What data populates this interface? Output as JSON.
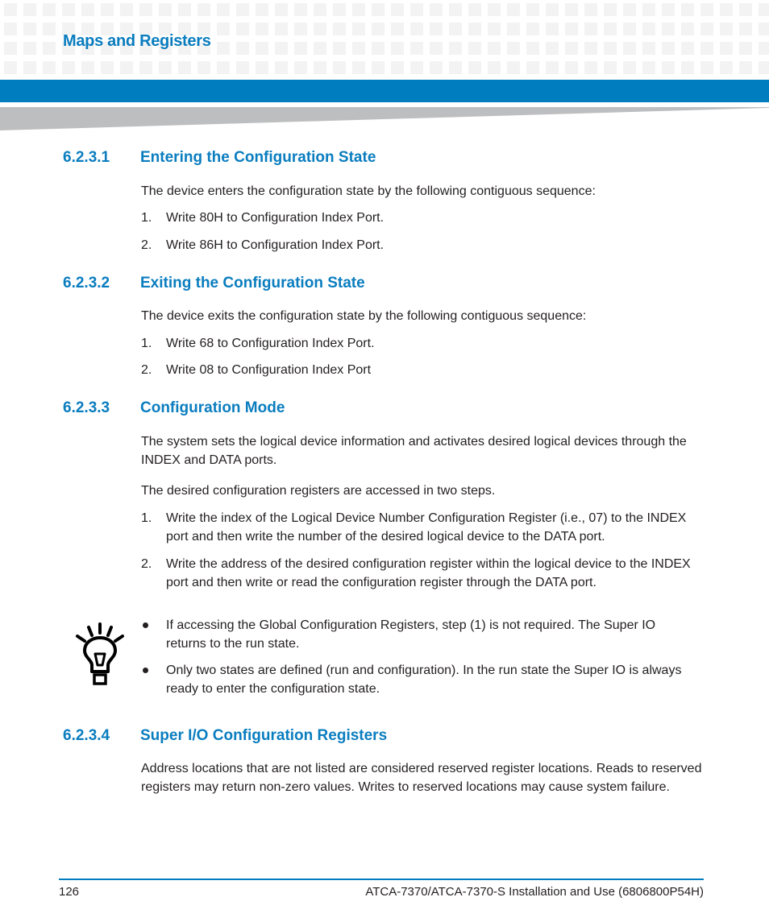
{
  "header": {
    "chapter_title": "Maps and Registers",
    "brand_color": "#007dbe"
  },
  "sections": [
    {
      "number": "6.2.3.1",
      "title": "Entering the Configuration State",
      "intro": "The device enters the configuration state by the following contiguous sequence:",
      "steps": [
        {
          "num": "1.",
          "text": "Write 80H to Configuration Index Port."
        },
        {
          "num": "2.",
          "text": "Write 86H to Configuration Index Port."
        }
      ]
    },
    {
      "number": "6.2.3.2",
      "title": "Exiting the Configuration State",
      "intro": "The device exits the configuration state by the following contiguous sequence:",
      "steps": [
        {
          "num": "1.",
          "text": "Write 68 to Configuration Index Port."
        },
        {
          "num": "2.",
          "text": "Write 08 to Configuration Index Port"
        }
      ]
    },
    {
      "number": "6.2.3.3",
      "title": "Configuration Mode",
      "paragraphs": [
        "The system sets the logical device information and activates desired logical devices through the INDEX and DATA ports.",
        "The desired configuration registers are accessed in two steps."
      ],
      "steps": [
        {
          "num": "1.",
          "text": "Write the index of the Logical Device Number Configuration Register (i.e., 07) to the INDEX port and then write the number of the desired logical device to the DATA port."
        },
        {
          "num": "2.",
          "text": "Write the address of the desired configuration register within the logical device to the INDEX port and then write or read the configuration register through the DATA port."
        }
      ],
      "note": {
        "icon": "lightbulb-icon",
        "bullets": [
          "If accessing the Global Configuration Registers, step (1) is not required. The Super IO returns to the run state.",
          "Only two states are defined (run and configuration). In the run state the Super IO is always ready to enter the configuration state."
        ]
      }
    },
    {
      "number": "6.2.3.4",
      "title": "Super I/O Configuration Registers",
      "paragraphs": [
        "Address locations that are not listed are considered reserved register locations. Reads to reserved registers may return non-zero values. Writes to reserved locations may cause system failure."
      ]
    }
  ],
  "footer": {
    "page_number": "126",
    "document_id": "ATCA-7370/ATCA-7370-S Installation and Use (6806800P54H)"
  }
}
